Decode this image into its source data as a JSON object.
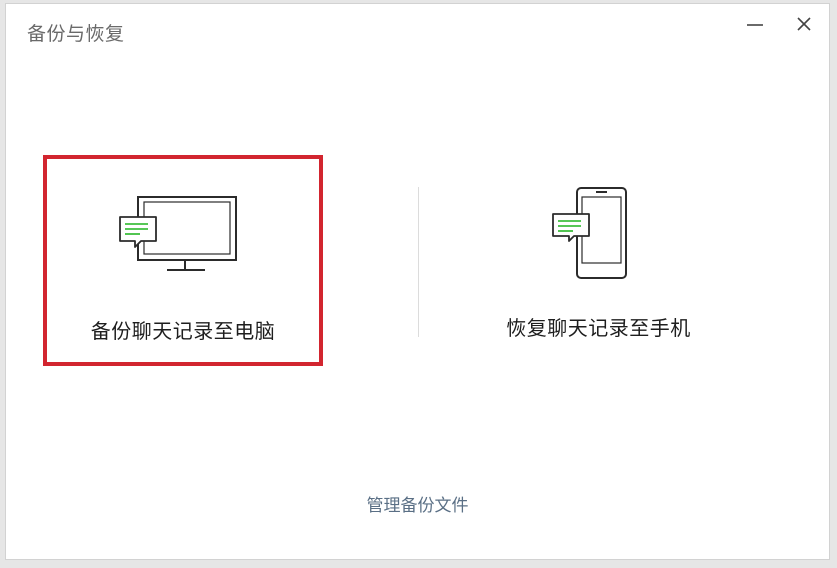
{
  "window": {
    "title": "备份与恢复"
  },
  "options": {
    "backup_to_pc": {
      "label": "备份聊天记录至电脑",
      "icon": "monitor-chat-icon",
      "selected": true
    },
    "restore_to_phone": {
      "label": "恢复聊天记录至手机",
      "icon": "phone-chat-icon",
      "selected": false
    }
  },
  "footer": {
    "manage_link": "管理备份文件"
  },
  "colors": {
    "selection_border": "#d2252f",
    "chat_lines": "#3fbf3f",
    "link": "#5a6f85"
  }
}
